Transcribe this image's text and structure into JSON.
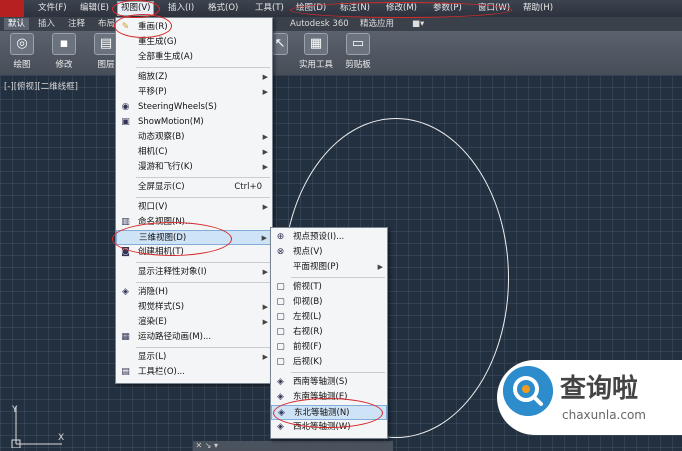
{
  "menubar": {
    "items": [
      "文件(F)",
      "编辑(E)",
      "视图(V)",
      "插入(I)",
      "格式(O)",
      "工具(T)",
      "绘图(D)",
      "标注(N)",
      "修改(M)",
      "参数(P)",
      "窗口(W)",
      "帮助(H)"
    ]
  },
  "tabs": [
    "默认",
    "插入",
    "注释",
    "布局",
    "Autodesk 360",
    "精选应用"
  ],
  "ribbon": {
    "buttons": [
      "绘图",
      "修改",
      "图层",
      "实用工具",
      "剪贴板"
    ]
  },
  "viewport": {
    "label": "[-][俯视][二维线框]"
  },
  "view_menu": {
    "items": [
      {
        "label": "重画(R)"
      },
      {
        "label": "重生成(G)"
      },
      {
        "label": "全部重生成(A)"
      },
      {
        "label": "缩放(Z)"
      },
      {
        "label": "平移(P)"
      },
      {
        "label": "SteeringWheels(S)"
      },
      {
        "label": "ShowMotion(M)"
      },
      {
        "label": "动态观察(B)"
      },
      {
        "label": "相机(C)"
      },
      {
        "label": "漫游和飞行(K)"
      },
      {
        "label": "全屏显示(C)",
        "shortcut": "Ctrl+0"
      },
      {
        "label": "视口(V)"
      },
      {
        "label": "命名视图(N)..."
      },
      {
        "label": "三维视图(D)"
      },
      {
        "label": "创建相机(T)"
      },
      {
        "label": "显示注释性对象(I)"
      },
      {
        "label": "消隐(H)"
      },
      {
        "label": "视觉样式(S)"
      },
      {
        "label": "渲染(E)"
      },
      {
        "label": "运动路径动画(M)..."
      },
      {
        "label": "显示(L)"
      },
      {
        "label": "工具栏(O)..."
      }
    ]
  },
  "submenu_3d": {
    "items": [
      {
        "label": "视点预设(I)..."
      },
      {
        "label": "视点(V)"
      },
      {
        "label": "平面视图(P)"
      },
      {
        "label": "俯视(T)"
      },
      {
        "label": "仰视(B)"
      },
      {
        "label": "左视(L)"
      },
      {
        "label": "右视(R)"
      },
      {
        "label": "前视(F)"
      },
      {
        "label": "后视(K)"
      },
      {
        "label": "西南等轴测(S)"
      },
      {
        "label": "东南等轴测(E)"
      },
      {
        "label": "东北等轴测(N)"
      },
      {
        "label": "西北等轴测(W)"
      }
    ]
  },
  "watermark": {
    "cn": "查询啦",
    "en": "chaxunla.com"
  },
  "ucs": {
    "y": "Y",
    "x": "X"
  },
  "colors": {
    "highlight": "#cfe3f6",
    "annotation": "#d62a2a",
    "grid": "#233040"
  }
}
